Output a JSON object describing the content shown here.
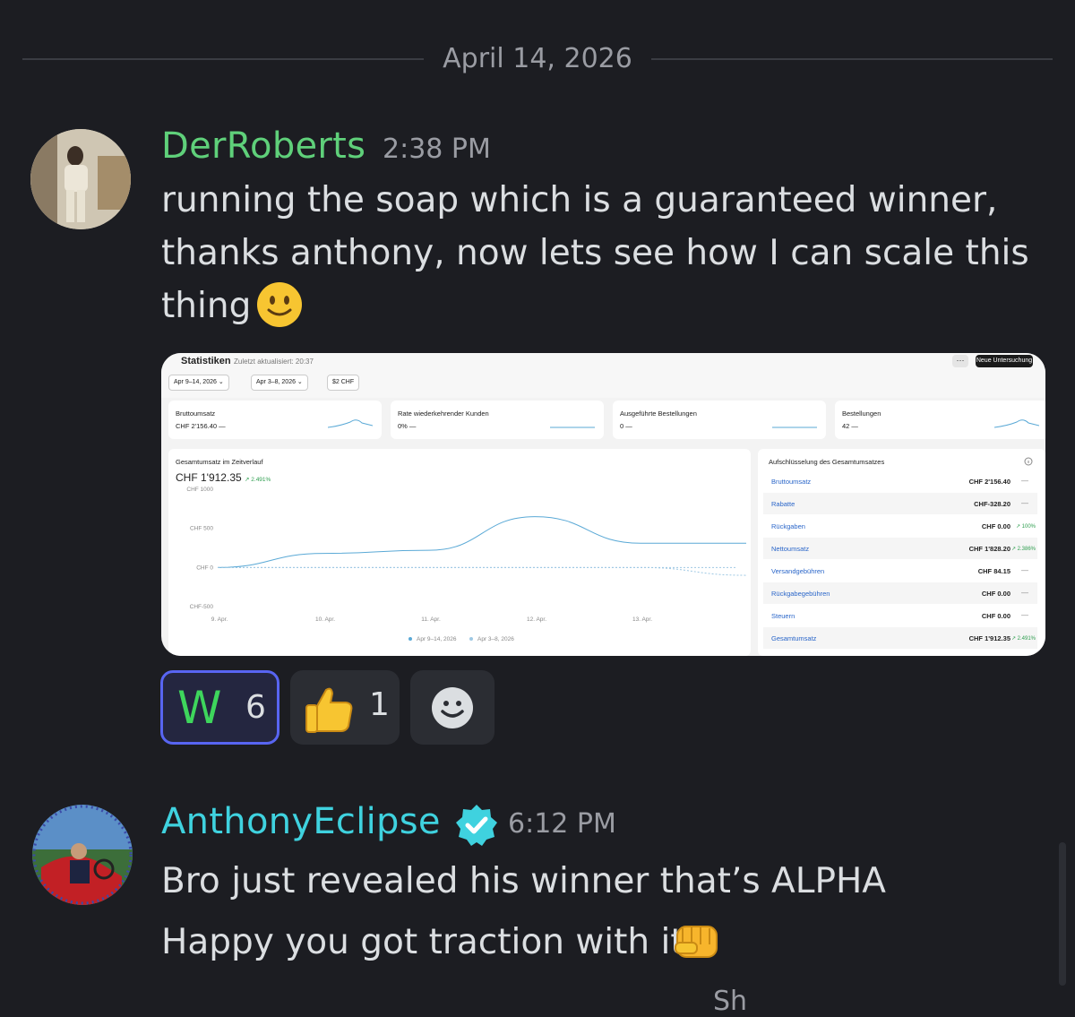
{
  "date_divider": "April 14, 2026",
  "messages": [
    {
      "author": "DerRoberts",
      "author_color": "#5fd07a",
      "time": "2:38 PM",
      "lines": [
        "running the soap which is a guaranteed winner,",
        "thanks anthony, now lets see how I can scale this",
        "thing"
      ],
      "emoji": "slightly-smiling-face"
    },
    {
      "author": "AnthonyEclipse",
      "author_color": "#3fd2df",
      "verified": true,
      "time": "6:12 PM",
      "lines": [
        "Bro just revealed his winner that’s ALPHA",
        "Happy you got traction with it"
      ],
      "emoji": "oncoming-fist"
    }
  ],
  "embed": {
    "title": "Statistiken",
    "subtitle": "Zuletzt aktualisiert: 20:37",
    "chips": [
      "Apr 9–14, 2026 ⌄",
      "Apr 3–8, 2026 ⌄",
      "$2 CHF"
    ],
    "more_button": "···",
    "new_button": "Neue Untersuchung",
    "kpis": [
      {
        "label": "Bruttoumsatz",
        "value": "CHF 2'156.40 —"
      },
      {
        "label": "Rate wiederkehrender Kunden",
        "value": "0% —"
      },
      {
        "label": "Ausgeführte Bestellungen",
        "value": "0 —"
      },
      {
        "label": "Bestellungen",
        "value": "42 —"
      }
    ],
    "chart": {
      "title": "Gesamtumsatz im Zeitverlauf",
      "total": "CHF 1'912.35",
      "change": "↗ 2.491%"
    },
    "breakdown": {
      "title": "Aufschlüsselung des Gesamtumsatzes",
      "info_icon": "info-icon",
      "rows": [
        {
          "label": "Bruttoumsatz",
          "value": "CHF 2'156.40",
          "change": "—"
        },
        {
          "label": "Rabatte",
          "value": "CHF-328.20",
          "change": "—"
        },
        {
          "label": "Rückgaben",
          "value": "CHF 0.00",
          "change": "↗ 100%"
        },
        {
          "label": "Nettoumsatz",
          "value": "CHF 1'828.20",
          "change": "↗ 2.386%"
        },
        {
          "label": "Versandgebühren",
          "value": "CHF 84.15",
          "change": "—"
        },
        {
          "label": "Rückgabegebühren",
          "value": "CHF 0.00",
          "change": "—"
        },
        {
          "label": "Steuern",
          "value": "CHF 0.00",
          "change": "—"
        },
        {
          "label": "Gesamtumsatz",
          "value": "CHF 1'912.35",
          "change": "↗ 2.491%"
        }
      ]
    }
  },
  "chart_data": {
    "type": "line",
    "title": "Gesamtumsatz im Zeitverlauf",
    "x": [
      "9. Apr.",
      "10. Apr.",
      "11. Apr.",
      "12. Apr.",
      "13. Apr.",
      "14. Apr."
    ],
    "y_ticks": [
      "CHF 1000",
      "CHF 500",
      "CHF 0",
      "CHF-500"
    ],
    "ylim": [
      -500,
      1000
    ],
    "series": [
      {
        "name": "Apr 9–14, 2026",
        "values": [
          0,
          180,
          220,
          650,
          310,
          310
        ],
        "color": "#5aa9d6"
      },
      {
        "name": "Apr 3–8, 2026",
        "values": [
          0,
          0,
          0,
          0,
          0,
          -100
        ],
        "color": "#9ec8e3"
      }
    ],
    "legend": "bottom"
  },
  "reactions": [
    {
      "emoji": "W",
      "count": "6",
      "selected": true
    },
    {
      "emoji": "thumbs-up",
      "count": "1",
      "selected": false
    },
    {
      "emoji": "add-reaction-icon",
      "count": "",
      "selected": false
    }
  ],
  "cutoff_text": "Sh"
}
